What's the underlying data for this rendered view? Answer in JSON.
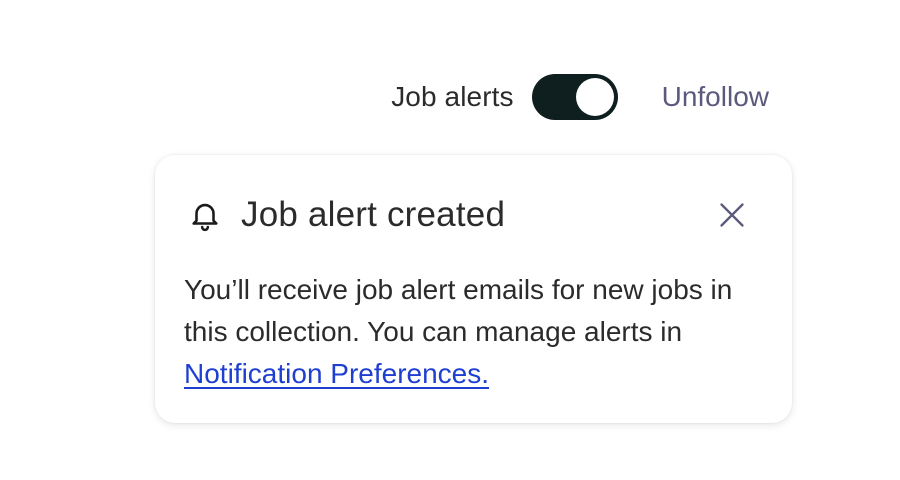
{
  "alerts_control": {
    "label": "Job alerts",
    "toggle_on": true,
    "unfollow_label": "Unfollow"
  },
  "notification": {
    "title": "Job alert created",
    "message": "You’ll receive job alert emails for new jobs in this collection. You can manage alerts in",
    "link_text": "Notification Preferences.",
    "icons": {
      "leading": "bell-icon",
      "close": "close-icon"
    }
  },
  "colors": {
    "toggle_track": "#0f1f20",
    "toggle_knob": "#ffffff",
    "unfollow_text": "#5b5a7c",
    "link": "#1e3fd0",
    "text": "#2b2b2b"
  }
}
